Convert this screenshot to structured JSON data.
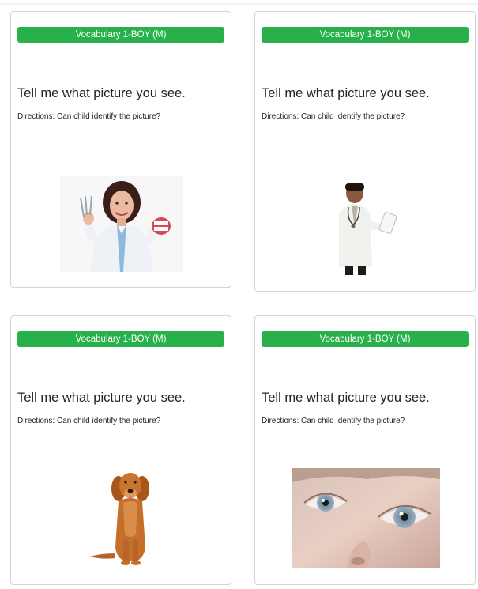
{
  "cards": [
    {
      "badge": "Vocabulary 1-BOY (M)",
      "prompt": "Tell me what picture you see.",
      "directions": "Directions: Can child identify the picture?",
      "image_icon": "dentist-photo-icon"
    },
    {
      "badge": "Vocabulary 1-BOY (M)",
      "prompt": "Tell me what picture you see.",
      "directions": "Directions: Can child identify the picture?",
      "image_icon": "doctor-photo-icon"
    },
    {
      "badge": "Vocabulary 1-BOY (M)",
      "prompt": "Tell me what picture you see.",
      "directions": "Directions: Can child identify the picture?",
      "image_icon": "dog-photo-icon"
    },
    {
      "badge": "Vocabulary 1-BOY (M)",
      "prompt": "Tell me what picture you see.",
      "directions": "Directions: Can child identify the picture?",
      "image_icon": "eye-photo-icon"
    }
  ],
  "colors": {
    "badge_bg": "#28b04b",
    "badge_text": "#ffffff",
    "card_border": "#d4d4d4"
  }
}
